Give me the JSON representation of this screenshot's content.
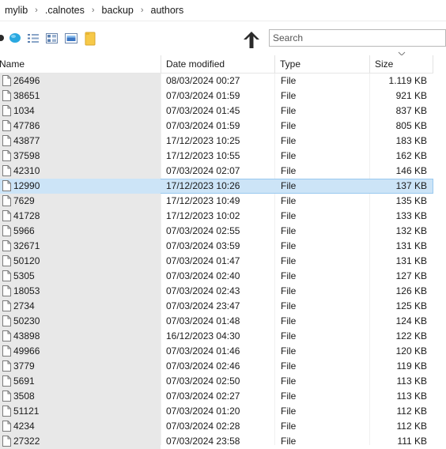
{
  "breadcrumb": [
    "mylib",
    ".calnotes",
    "backup",
    "authors"
  ],
  "toolbar": {
    "icons": [
      "circle-icon",
      "globe-icon",
      "details-view-icon",
      "tiles-view-icon",
      "image-icon",
      "folder-icon",
      "up-arrow-icon"
    ]
  },
  "search": {
    "placeholder": "Search",
    "value": ""
  },
  "columns": {
    "name": "Name",
    "date": "Date modified",
    "type": "Type",
    "size": "Size",
    "sort": "size-descending"
  },
  "selected_row": "12990",
  "files": [
    {
      "name": "26496",
      "date": "08/03/2024 00:27",
      "type": "File",
      "size": "1.119 KB"
    },
    {
      "name": "38651",
      "date": "07/03/2024 01:59",
      "type": "File",
      "size": "921 KB"
    },
    {
      "name": "1034",
      "date": "07/03/2024 01:45",
      "type": "File",
      "size": "837 KB"
    },
    {
      "name": "47786",
      "date": "07/03/2024 01:59",
      "type": "File",
      "size": "805 KB"
    },
    {
      "name": "43877",
      "date": "17/12/2023 10:25",
      "type": "File",
      "size": "183 KB"
    },
    {
      "name": "37598",
      "date": "17/12/2023 10:55",
      "type": "File",
      "size": "162 KB"
    },
    {
      "name": "42310",
      "date": "07/03/2024 02:07",
      "type": "File",
      "size": "146 KB"
    },
    {
      "name": "12990",
      "date": "17/12/2023 10:26",
      "type": "File",
      "size": "137 KB"
    },
    {
      "name": "7629",
      "date": "17/12/2023 10:49",
      "type": "File",
      "size": "135 KB"
    },
    {
      "name": "41728",
      "date": "17/12/2023 10:02",
      "type": "File",
      "size": "133 KB"
    },
    {
      "name": "5966",
      "date": "07/03/2024 02:55",
      "type": "File",
      "size": "132 KB"
    },
    {
      "name": "32671",
      "date": "07/03/2024 03:59",
      "type": "File",
      "size": "131 KB"
    },
    {
      "name": "50120",
      "date": "07/03/2024 01:47",
      "type": "File",
      "size": "131 KB"
    },
    {
      "name": "5305",
      "date": "07/03/2024 02:40",
      "type": "File",
      "size": "127 KB"
    },
    {
      "name": "18053",
      "date": "07/03/2024 02:43",
      "type": "File",
      "size": "126 KB"
    },
    {
      "name": "2734",
      "date": "07/03/2024 23:47",
      "type": "File",
      "size": "125 KB"
    },
    {
      "name": "50230",
      "date": "07/03/2024 01:48",
      "type": "File",
      "size": "124 KB"
    },
    {
      "name": "43898",
      "date": "16/12/2023 04:30",
      "type": "File",
      "size": "122 KB"
    },
    {
      "name": "49966",
      "date": "07/03/2024 01:46",
      "type": "File",
      "size": "120 KB"
    },
    {
      "name": "3779",
      "date": "07/03/2024 02:46",
      "type": "File",
      "size": "119 KB"
    },
    {
      "name": "5691",
      "date": "07/03/2024 02:50",
      "type": "File",
      "size": "113 KB"
    },
    {
      "name": "3508",
      "date": "07/03/2024 02:27",
      "type": "File",
      "size": "113 KB"
    },
    {
      "name": "51121",
      "date": "07/03/2024 01:20",
      "type": "File",
      "size": "112 KB"
    },
    {
      "name": "4234",
      "date": "07/03/2024 02:28",
      "type": "File",
      "size": "112 KB"
    },
    {
      "name": "27322",
      "date": "07/03/2024 23:58",
      "type": "File",
      "size": "111 KB"
    }
  ]
}
